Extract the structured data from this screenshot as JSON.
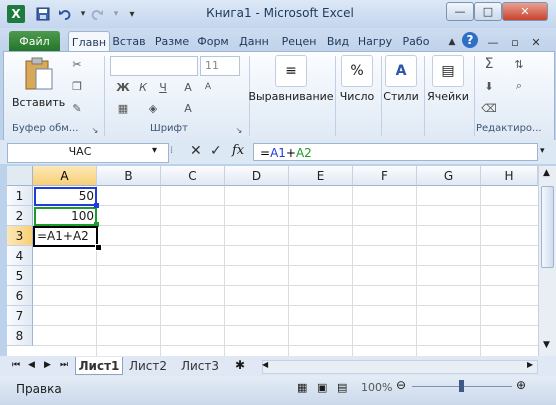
{
  "window": {
    "title": "Книга1  -  Microsoft Excel",
    "app_icon": "X"
  },
  "qat": {
    "save_icon": "save-icon",
    "undo_icon": "undo-icon",
    "redo_icon": "redo-icon"
  },
  "tabs": {
    "file": "Файл",
    "items": [
      "Главн",
      "Встав",
      "Разме",
      "Форм",
      "Данн",
      "Рецен",
      "Вид",
      "Нагру",
      "Рабо"
    ]
  },
  "ribbon": {
    "clipboard_group": "Буфер обм...",
    "paste_label": "Вставить",
    "font_group": "Шрифт",
    "font_size": "11",
    "alignment_label": "Выравнивание",
    "number_label": "Число",
    "styles_label": "Стили",
    "cells_label": "Ячейки",
    "editing_group": "Редактиро..."
  },
  "formula_bar": {
    "name_box": "ЧАС",
    "formula": "=A1+A2"
  },
  "grid": {
    "columns": [
      "A",
      "B",
      "C",
      "D",
      "E",
      "F",
      "G",
      "H"
    ],
    "rows": [
      "1",
      "2",
      "3",
      "4",
      "5",
      "6",
      "7",
      "8"
    ],
    "cells": {
      "A1": "50",
      "A2": "100",
      "A3": "=A1+A2"
    }
  },
  "sheets": [
    "Лист1",
    "Лист2",
    "Лист3"
  ],
  "status": {
    "mode": "Правка",
    "zoom": "100%"
  },
  "colors": {
    "file_tab": "#23762a",
    "ref_a1": "#1f3ddb",
    "ref_a2": "#1a9b2a"
  }
}
